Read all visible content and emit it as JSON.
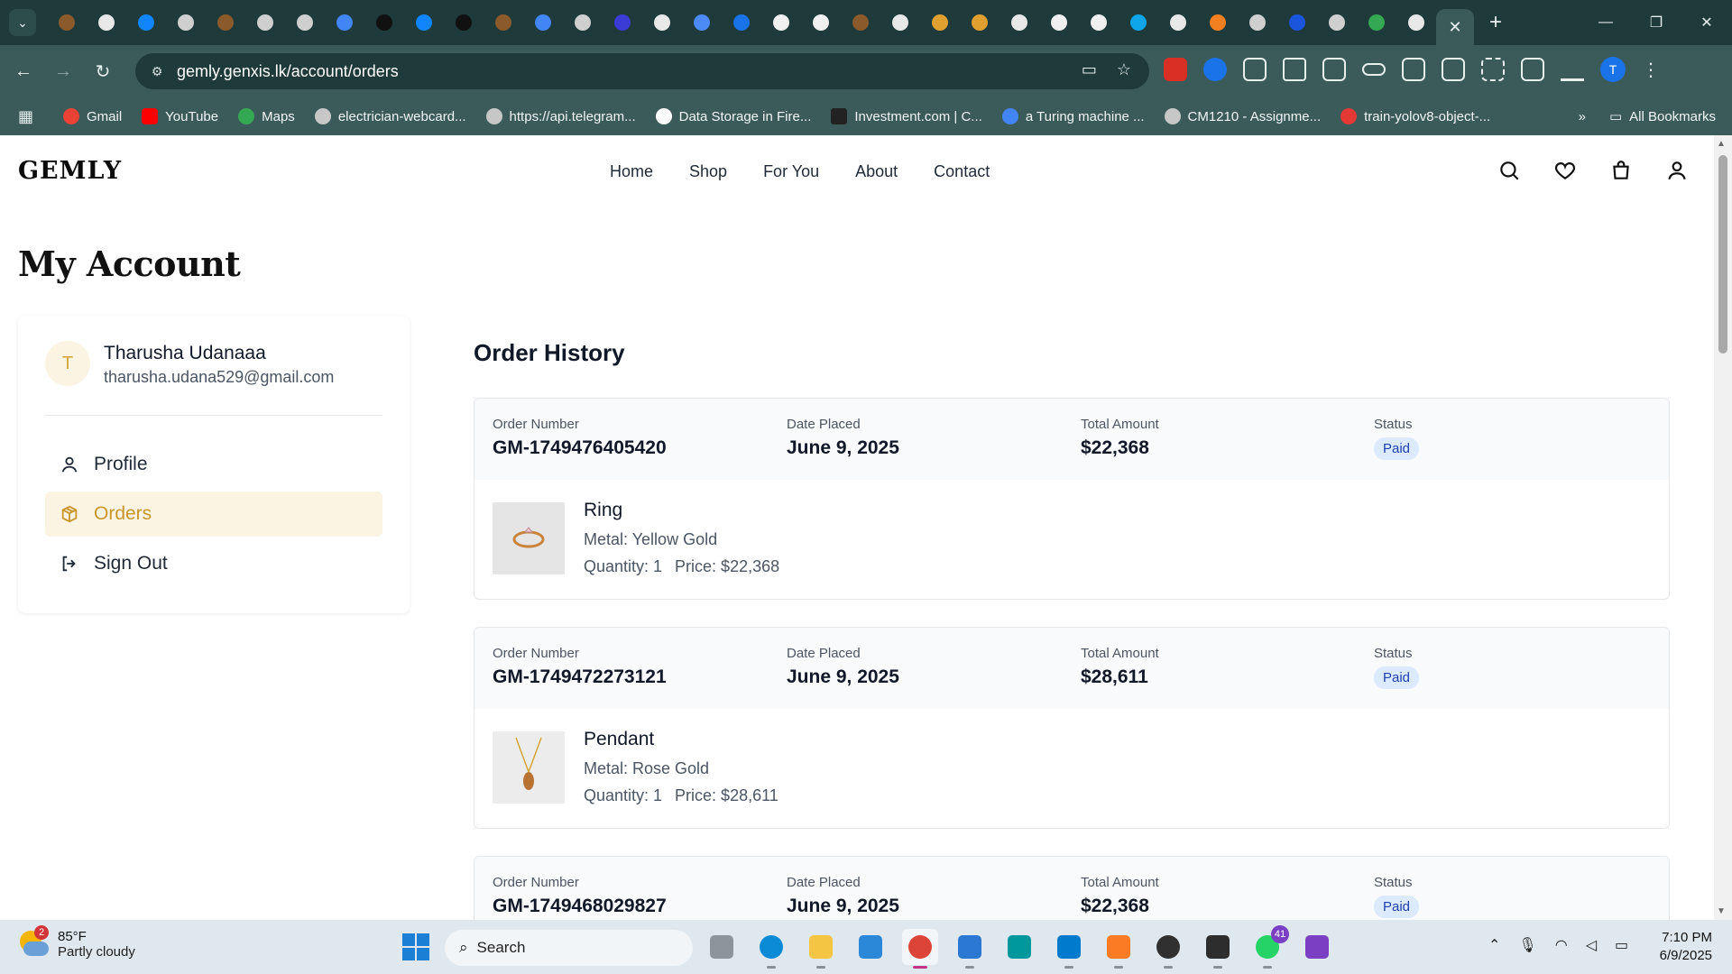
{
  "browser": {
    "url": "gemly.genxis.lk/account/orders",
    "bookmarks": [
      {
        "label": "Gmail",
        "color": "#ea4335"
      },
      {
        "label": "YouTube",
        "color": "#ff0000"
      },
      {
        "label": "Maps",
        "color": "#34a853"
      },
      {
        "label": "electrician-webcard...",
        "color": "#c7c7c7"
      },
      {
        "label": "https://api.telegram...",
        "color": "#c7c7c7"
      },
      {
        "label": "Data Storage in Fire...",
        "color": "#ffffff"
      },
      {
        "label": "Investment.com | C...",
        "color": "#222222"
      },
      {
        "label": "a Turing machine ...",
        "color": "#4285f4"
      },
      {
        "label": "CM1210 - Assignme...",
        "color": "#c7c7c7"
      },
      {
        "label": "train-yolov8-object-...",
        "color": "#e53935"
      }
    ],
    "all_bookmarks": "All Bookmarks",
    "profile_initial": "T"
  },
  "site": {
    "logo": "GEMLY",
    "nav": [
      "Home",
      "Shop",
      "For You",
      "About",
      "Contact"
    ]
  },
  "account": {
    "title": "My Account",
    "user": {
      "initial": "T",
      "name": "Tharusha Udanaaa",
      "email": "tharusha.udana529@gmail.com"
    },
    "menu": {
      "profile": "Profile",
      "orders": "Orders",
      "sign_out": "Sign Out"
    }
  },
  "orders": {
    "title": "Order History",
    "labels": {
      "number": "Order Number",
      "date": "Date Placed",
      "total": "Total Amount",
      "status": "Status"
    },
    "items": [
      {
        "number": "GM-1749476405420",
        "date": "June 9, 2025",
        "total": "$22,368",
        "status": "Paid",
        "product": "Ring",
        "metal": "Metal: Yellow Gold",
        "quantity": "Quantity: 1",
        "price": "Price: $22,368"
      },
      {
        "number": "GM-1749472273121",
        "date": "June 9, 2025",
        "total": "$28,611",
        "status": "Paid",
        "product": "Pendant",
        "metal": "Metal: Rose Gold",
        "quantity": "Quantity: 1",
        "price": "Price: $28,611"
      },
      {
        "number": "GM-1749468029827",
        "date": "June 9, 2025",
        "total": "$22,368",
        "status": "Paid"
      }
    ]
  },
  "taskbar": {
    "weather_badge": "2",
    "temp": "85°F",
    "condition": "Partly cloudy",
    "search": "Search",
    "whatsapp_badge": "41",
    "time": "7:10 PM",
    "date": "6/9/2025"
  }
}
